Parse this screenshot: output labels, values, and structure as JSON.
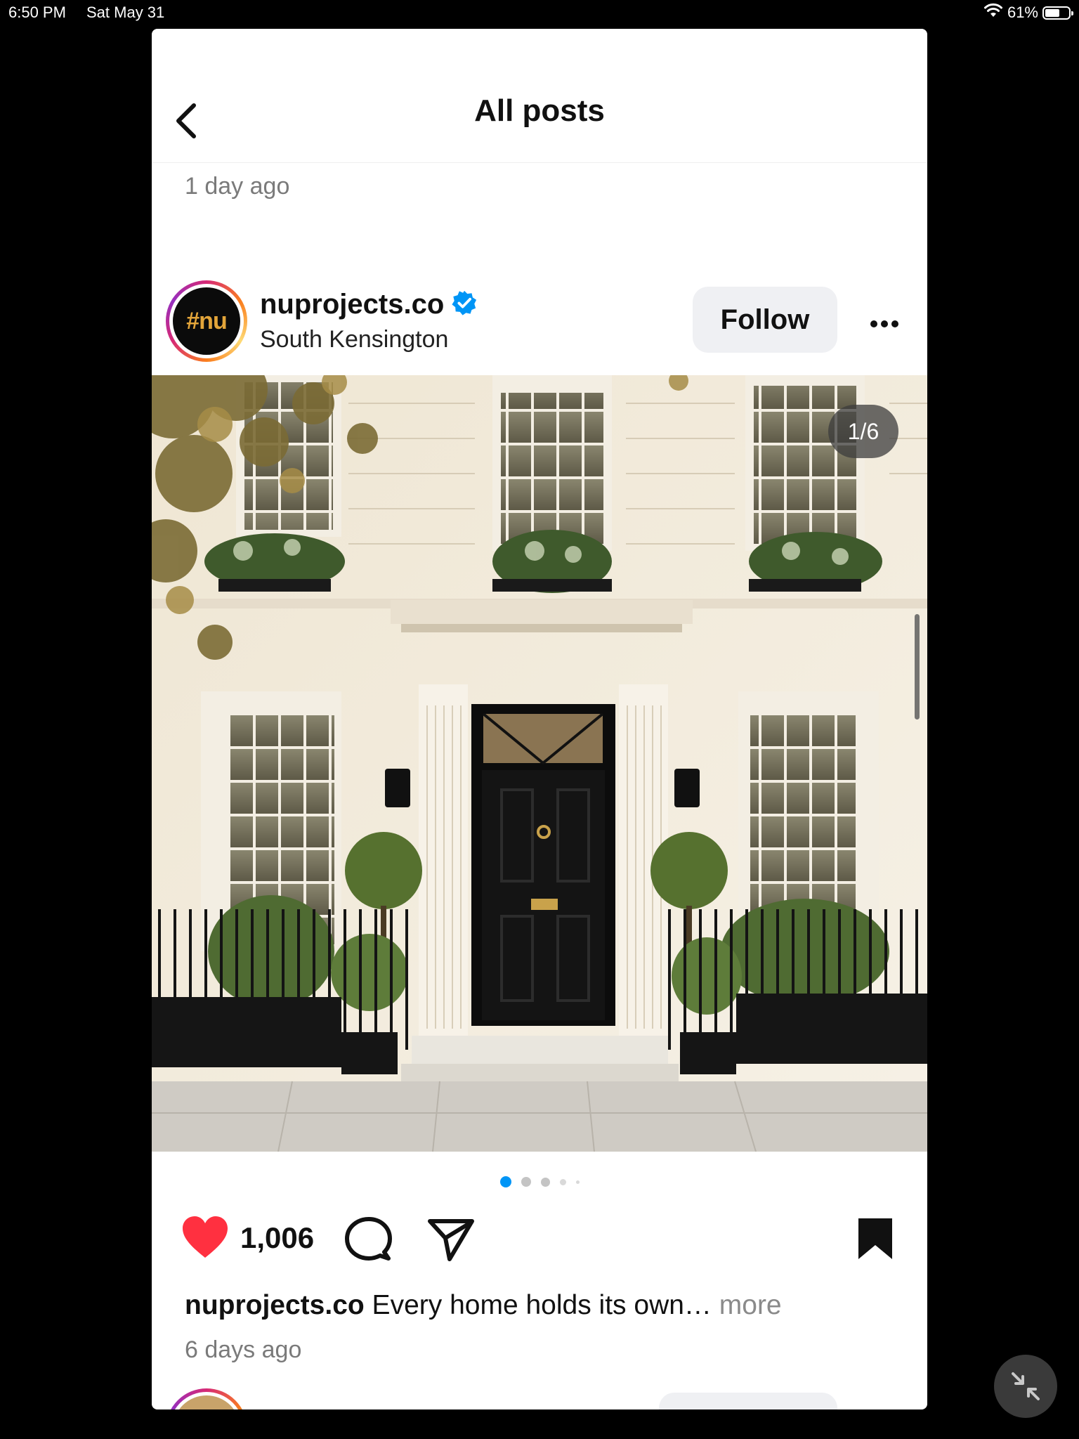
{
  "status_bar": {
    "time": "6:50 PM",
    "date": "Sat May 31",
    "battery_text": "61%",
    "battery_level": 0.61,
    "wifi_icon": "wifi-icon"
  },
  "nav": {
    "title": "All posts",
    "back_icon": "chevron-left-icon"
  },
  "previous_post": {
    "time": "1 day ago"
  },
  "post": {
    "avatar_text": "#nu",
    "username": "nuprojects.co",
    "verified": true,
    "location": "South Kensington",
    "follow_label": "Follow",
    "more_icon": "more-horizontal-icon",
    "image_counter": "1/6",
    "carousel_dots": 5,
    "carousel_active_index": 0,
    "likes": "1,006",
    "liked": true,
    "bookmarked": true,
    "caption_user": "nuprojects.co",
    "caption_text": " Every home holds its own… ",
    "caption_more": "more",
    "time": "6 days ago"
  },
  "colors": {
    "like_red": "#ff3040",
    "verified_blue": "#0095f6",
    "dot_active": "#0095f6",
    "follow_bg": "#eff0f3"
  },
  "icons": {
    "like": "heart-icon",
    "comment": "comment-icon",
    "share": "send-icon",
    "save": "bookmark-icon",
    "minimize": "minimize-icon"
  }
}
